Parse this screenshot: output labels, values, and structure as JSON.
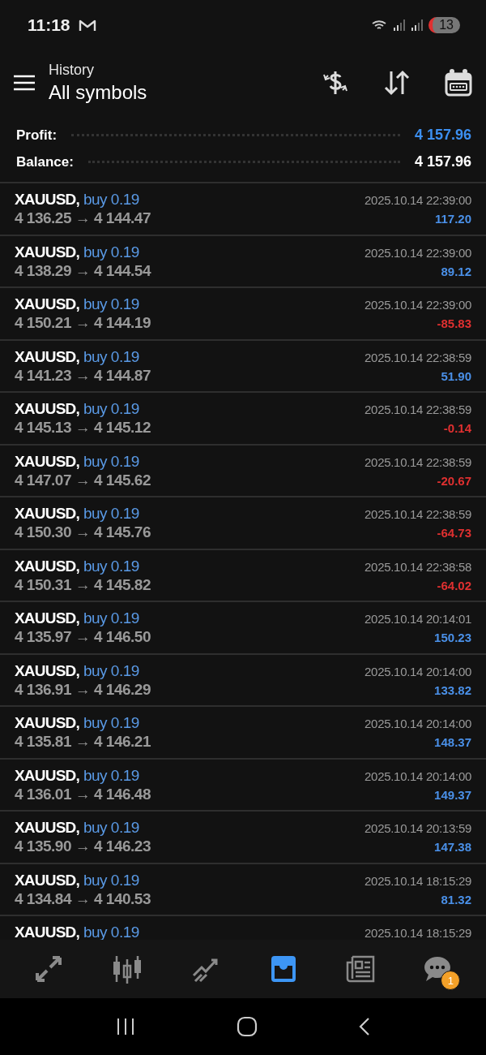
{
  "status_bar": {
    "time": "11:18",
    "notification_count": "13"
  },
  "header": {
    "subtitle": "History",
    "title": "All symbols"
  },
  "summary": [
    {
      "label": "Profit:",
      "value": "4 157.96",
      "kind": "profit"
    },
    {
      "label": "Balance:",
      "value": "4 157.96",
      "kind": "balance"
    }
  ],
  "deals": [
    {
      "symbol": "XAUUSD,",
      "side": "buy 0.19",
      "prices": "4 136.25 → 4 144.47",
      "time": "2025.10.14 22:39:00",
      "profit": "117.20",
      "loss": false
    },
    {
      "symbol": "XAUUSD,",
      "side": "buy 0.19",
      "prices": "4 138.29 → 4 144.54",
      "time": "2025.10.14 22:39:00",
      "profit": "89.12",
      "loss": false
    },
    {
      "symbol": "XAUUSD,",
      "side": "buy 0.19",
      "prices": "4 150.21 → 4 144.19",
      "time": "2025.10.14 22:39:00",
      "profit": "-85.83",
      "loss": true
    },
    {
      "symbol": "XAUUSD,",
      "side": "buy 0.19",
      "prices": "4 141.23 → 4 144.87",
      "time": "2025.10.14 22:38:59",
      "profit": "51.90",
      "loss": false
    },
    {
      "symbol": "XAUUSD,",
      "side": "buy 0.19",
      "prices": "4 145.13 → 4 145.12",
      "time": "2025.10.14 22:38:59",
      "profit": "-0.14",
      "loss": true
    },
    {
      "symbol": "XAUUSD,",
      "side": "buy 0.19",
      "prices": "4 147.07 → 4 145.62",
      "time": "2025.10.14 22:38:59",
      "profit": "-20.67",
      "loss": true
    },
    {
      "symbol": "XAUUSD,",
      "side": "buy 0.19",
      "prices": "4 150.30 → 4 145.76",
      "time": "2025.10.14 22:38:59",
      "profit": "-64.73",
      "loss": true
    },
    {
      "symbol": "XAUUSD,",
      "side": "buy 0.19",
      "prices": "4 150.31 → 4 145.82",
      "time": "2025.10.14 22:38:58",
      "profit": "-64.02",
      "loss": true
    },
    {
      "symbol": "XAUUSD,",
      "side": "buy 0.19",
      "prices": "4 135.97 → 4 146.50",
      "time": "2025.10.14 20:14:01",
      "profit": "150.23",
      "loss": false
    },
    {
      "symbol": "XAUUSD,",
      "side": "buy 0.19",
      "prices": "4 136.91 → 4 146.29",
      "time": "2025.10.14 20:14:00",
      "profit": "133.82",
      "loss": false
    },
    {
      "symbol": "XAUUSD,",
      "side": "buy 0.19",
      "prices": "4 135.81 → 4 146.21",
      "time": "2025.10.14 20:14:00",
      "profit": "148.37",
      "loss": false
    },
    {
      "symbol": "XAUUSD,",
      "side": "buy 0.19",
      "prices": "4 136.01 → 4 146.48",
      "time": "2025.10.14 20:14:00",
      "profit": "149.37",
      "loss": false
    },
    {
      "symbol": "XAUUSD,",
      "side": "buy 0.19",
      "prices": "4 135.90 → 4 146.23",
      "time": "2025.10.14 20:13:59",
      "profit": "147.38",
      "loss": false
    },
    {
      "symbol": "XAUUSD,",
      "side": "buy 0.19",
      "prices": "4 134.84 → 4 140.53",
      "time": "2025.10.14 18:15:29",
      "profit": "81.32",
      "loss": false
    },
    {
      "symbol": "XAUUSD,",
      "side": "buy 0.19",
      "time": "2025.10.14 18:15:29"
    }
  ],
  "bottom_nav": [
    {
      "kind": "trade",
      "selected": false
    },
    {
      "kind": "quotes",
      "selected": false
    },
    {
      "kind": "chart",
      "selected": false
    },
    {
      "kind": "history",
      "selected": true
    },
    {
      "kind": "news",
      "selected": false
    },
    {
      "kind": "chat",
      "selected": false,
      "badge": "1"
    }
  ]
}
